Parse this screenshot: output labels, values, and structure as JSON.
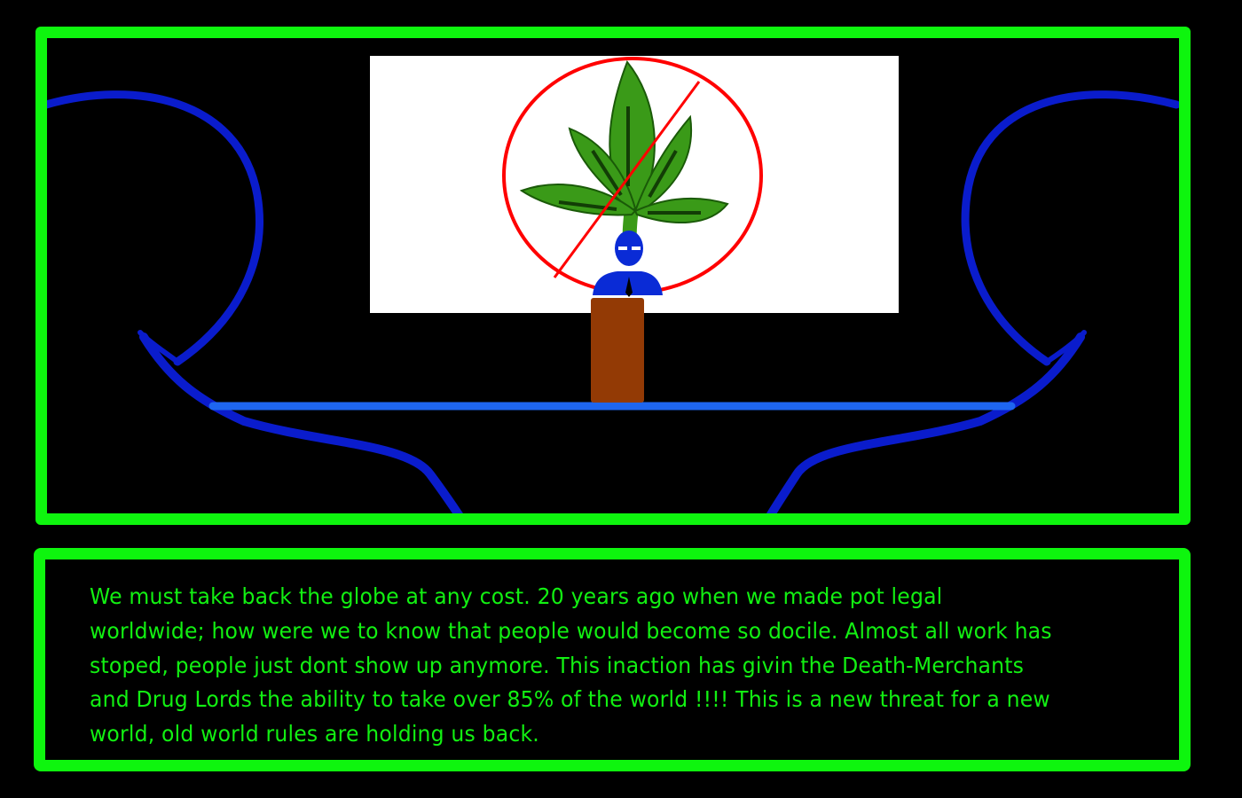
{
  "scene": {
    "screen_image": "no-marijuana-sign",
    "speaker": "blue-figure-in-suit",
    "colors": {
      "frame": "#0ef50e",
      "background": "#000000",
      "screen": "#ffffff",
      "prohibition": "#ff0000",
      "leaf": "#3a9a18",
      "figure": "#0a2bd6",
      "stage_line": "#1e66f0",
      "podium": "#933a05",
      "curves": "#0a1ccc"
    }
  },
  "dialog": {
    "text": "We must take back the globe at any cost. 20 years ago when we made pot legal worldwide; how were we to know that people would become so docile. Almost all work has stoped, people just dont show up anymore. This inaction has givin the Death-Merchants and Drug Lords the ability to take over 85% of the world !!!! This is a new threat for a new world, old world rules are holding us back.",
    "color": "#12f012"
  }
}
